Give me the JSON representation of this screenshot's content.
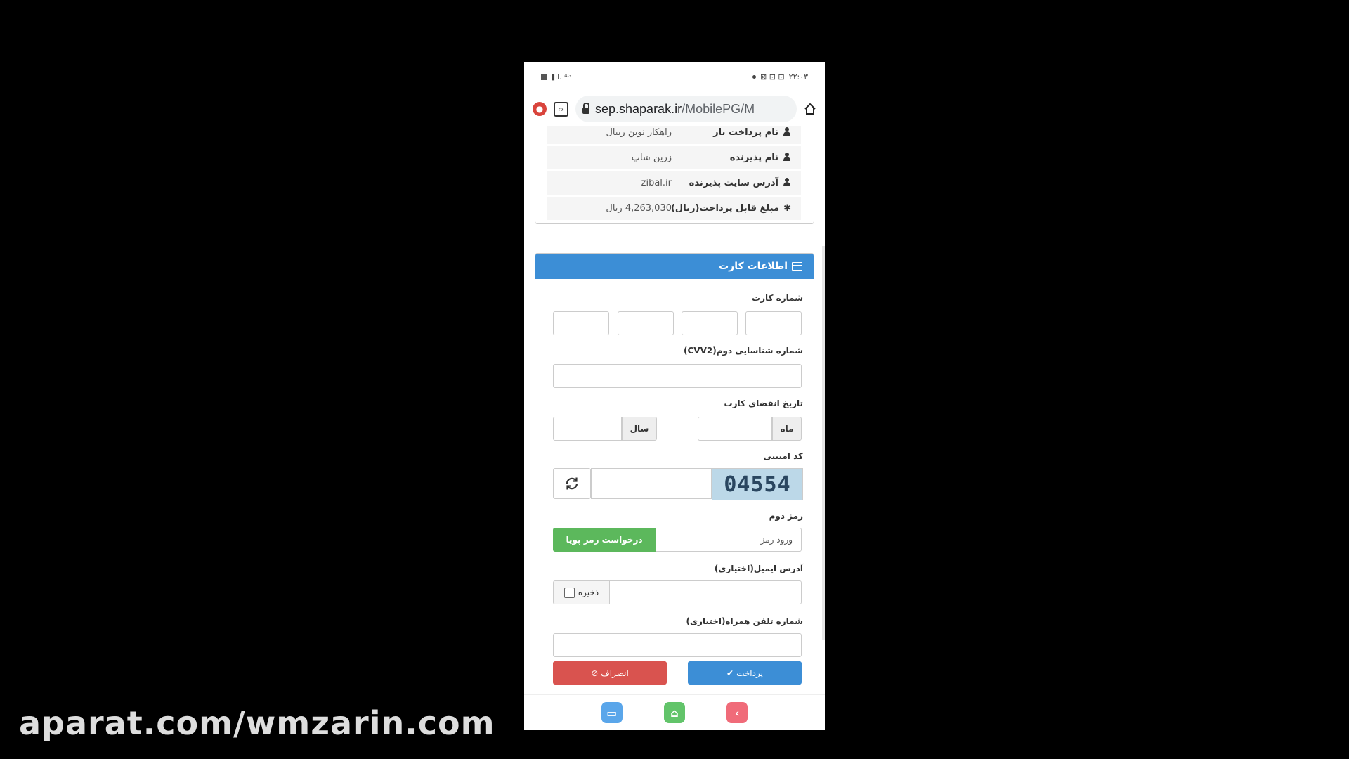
{
  "status_bar": {
    "left_icons": "▮ıl. ⁴ᴳ",
    "time": "۲۲:۰۳"
  },
  "browser": {
    "tab_count": "۲۶",
    "url_domain": "sep.shaparak.ir",
    "url_path": "/MobilePG/M"
  },
  "merchant_info": [
    {
      "label": "نام پرداخت یار",
      "value": "راهکار نوین زیبال",
      "icon": "user-icon"
    },
    {
      "label": "نام پذیرنده",
      "value": "زرین شاپ",
      "icon": "user-icon"
    },
    {
      "label": "آدرس سایت پذیرنده",
      "value": "zibal.ir",
      "icon": "user-icon"
    },
    {
      "label": "مبلغ قابل پرداخت(ریال)",
      "value": "4,263,030 ریال",
      "icon": "asterisk-icon"
    }
  ],
  "card_panel": {
    "title": "اطلاعات کارت",
    "card_number_label": "شماره کارت",
    "cvv2_label": "شماره شناسایی دوم(CVV2)",
    "expiry_label": "تاریخ انقضای کارت",
    "month_label": "ماه",
    "year_label": "سال",
    "captcha_label": "کد امنیتی",
    "captcha_value": "04554",
    "password_label": "رمز دوم",
    "password_placeholder": "ورود رمز",
    "dynamic_password_button": "درخواست رمز پویا",
    "email_label": "آدرس ایمیل(اختیاری)",
    "save_label": "ذخیره",
    "mobile_label": "شماره تلفن همراه(اختیاری)",
    "pay_button": "پرداخت",
    "cancel_button": "انصراف"
  },
  "watermark": "aparat.com/wmzarin.com",
  "colors": {
    "primary": "#3c8ed6",
    "success": "#5cb85c",
    "danger": "#d9534f"
  }
}
